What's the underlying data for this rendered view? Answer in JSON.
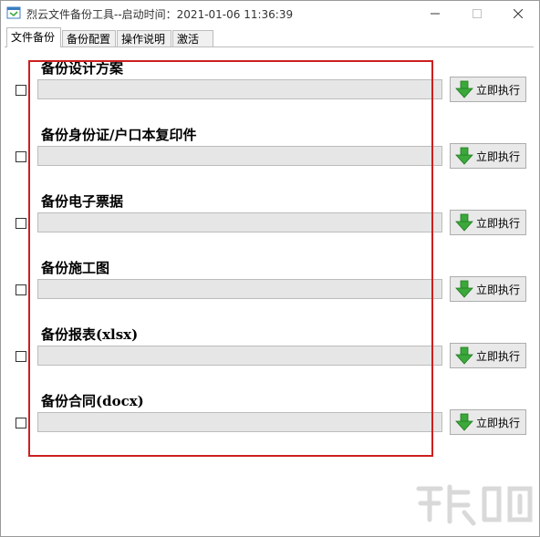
{
  "window": {
    "title": "烈云文件备份工具--启动时间：2021-01-06 11:36:39"
  },
  "tabs": [
    {
      "label": "文件备份",
      "active": true
    },
    {
      "label": "备份配置",
      "active": false
    },
    {
      "label": "操作说明",
      "active": false
    },
    {
      "label": "激活",
      "active": false
    }
  ],
  "rows": [
    {
      "title": "备份设计方案",
      "checked": false,
      "button": "立即执行"
    },
    {
      "title": "备份身份证/户口本复印件",
      "checked": false,
      "button": "立即执行"
    },
    {
      "title": "备份电子票据",
      "checked": false,
      "button": "立即执行"
    },
    {
      "title": "备份施工图",
      "checked": false,
      "button": "立即执行"
    },
    {
      "title": "备份报表(xlsx)",
      "checked": false,
      "button": "立即执行"
    },
    {
      "title": "备份合同(docx)",
      "checked": false,
      "button": "立即执行"
    }
  ],
  "colors": {
    "highlight": "#cc1f1f",
    "run_arrow": "#3aa83a"
  },
  "icons": {
    "app": "app-window-icon",
    "run": "green-down-arrow-icon"
  }
}
